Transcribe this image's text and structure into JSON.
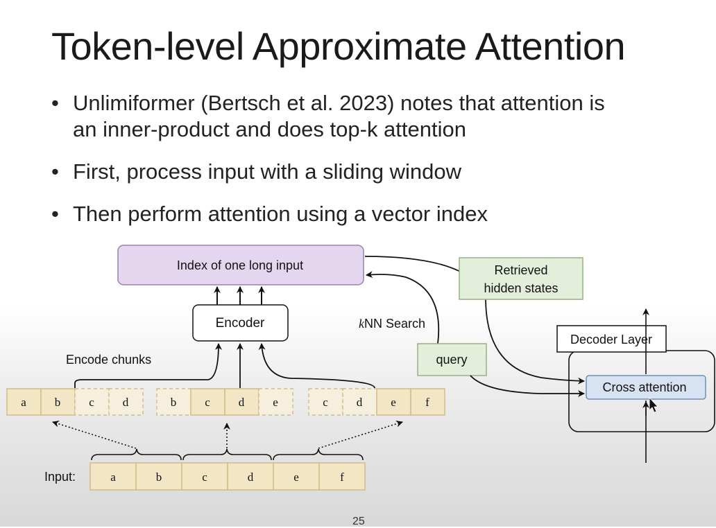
{
  "slide": {
    "title": "Token-level Approximate Attention",
    "bullets": [
      {
        "lines": [
          "Unlimiformer (Bertsch et al. 2023) notes that attention is",
          "an inner-product and does top-k attention"
        ]
      },
      {
        "lines": [
          "First, process input with a sliding window"
        ]
      },
      {
        "lines": [
          "Then perform attention using a vector index"
        ]
      }
    ],
    "page_number": "25"
  },
  "diagram": {
    "index_label": "Index of one long input",
    "encoder_label": "Encoder",
    "encode_chunks_label": "Encode chunks",
    "knn_label_k": "k",
    "knn_label_rest": "NN Search",
    "retrieved_line1": "Retrieved",
    "retrieved_line2": "hidden states",
    "query_label": "query",
    "decoder_layer_label": "Decoder Layer",
    "cross_attention_label": "Cross attention",
    "input_label": "Input:",
    "input_tokens": [
      "a",
      "b",
      "c",
      "d",
      "e",
      "f"
    ],
    "chunk_tokens": [
      [
        "a",
        "b",
        "c",
        "d"
      ],
      [
        "b",
        "c",
        "d",
        "e"
      ],
      [
        "c",
        "d",
        "e",
        "f"
      ]
    ],
    "colors": {
      "index_fill": "#e3d6ee",
      "index_stroke": "#9b7fb4",
      "green_fill": "#e3eedb",
      "green_stroke": "#94b480",
      "cross_fill": "#d7e3f2",
      "cross_stroke": "#6f8fb8",
      "token_fill": "#f2e6c4",
      "token_stroke": "#c9b27a"
    }
  }
}
